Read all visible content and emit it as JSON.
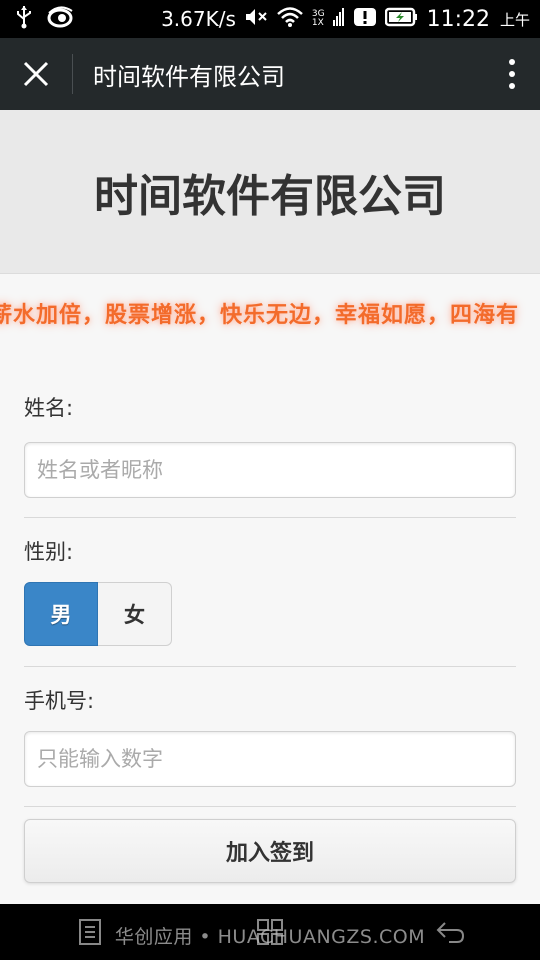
{
  "status_bar": {
    "speed": "3.67K/s",
    "network_top": "3G",
    "network_bottom": "1X",
    "time": "11:22",
    "ampm": "上午",
    "icons": [
      "usb-icon",
      "app-icon",
      "mute-icon",
      "wifi-icon",
      "signal-icon",
      "alert-icon",
      "battery-charging-icon"
    ]
  },
  "app_bar": {
    "title": "时间软件有限公司"
  },
  "header": {
    "title": "时间软件有限公司"
  },
  "marquee": {
    "text": "薪水加倍，股票增涨，快乐无边，幸福如愿，四海有"
  },
  "form": {
    "name": {
      "label": "姓名:",
      "placeholder": "姓名或者昵称"
    },
    "gender": {
      "label": "性别:",
      "options": [
        "男",
        "女"
      ],
      "selected": "男"
    },
    "phone": {
      "label": "手机号:",
      "placeholder": "只能输入数字"
    },
    "submit_label": "加入签到"
  },
  "watermark": "华创应用 • HUACHUANGZS.COM",
  "colors": {
    "accent": "#3a86c8",
    "marquee": "#f36b2b",
    "app_bar": "#24292b"
  }
}
